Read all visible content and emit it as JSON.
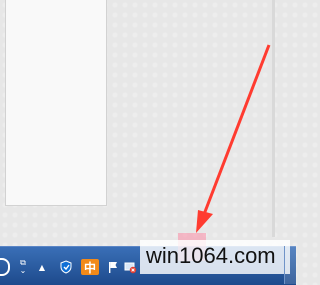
{
  "watermark": {
    "text": "win1064.com"
  },
  "tray": {
    "items": [
      {
        "name": "tray-display-icon",
        "glyph": "⧉"
      },
      {
        "name": "tray-expand-icon",
        "glyph": "▲"
      },
      {
        "name": "shield-icon",
        "glyph": "⛨"
      },
      {
        "name": "ime-icon",
        "label": "中"
      },
      {
        "name": "flag-icon",
        "glyph": "⚑"
      },
      {
        "name": "network-icon",
        "glyph": "✕"
      }
    ]
  },
  "colors": {
    "taskbar": "#2b5ea6",
    "arrow": "#ff3b30",
    "background": "#e7e7e7",
    "ime_badge": "#f28a1a"
  }
}
